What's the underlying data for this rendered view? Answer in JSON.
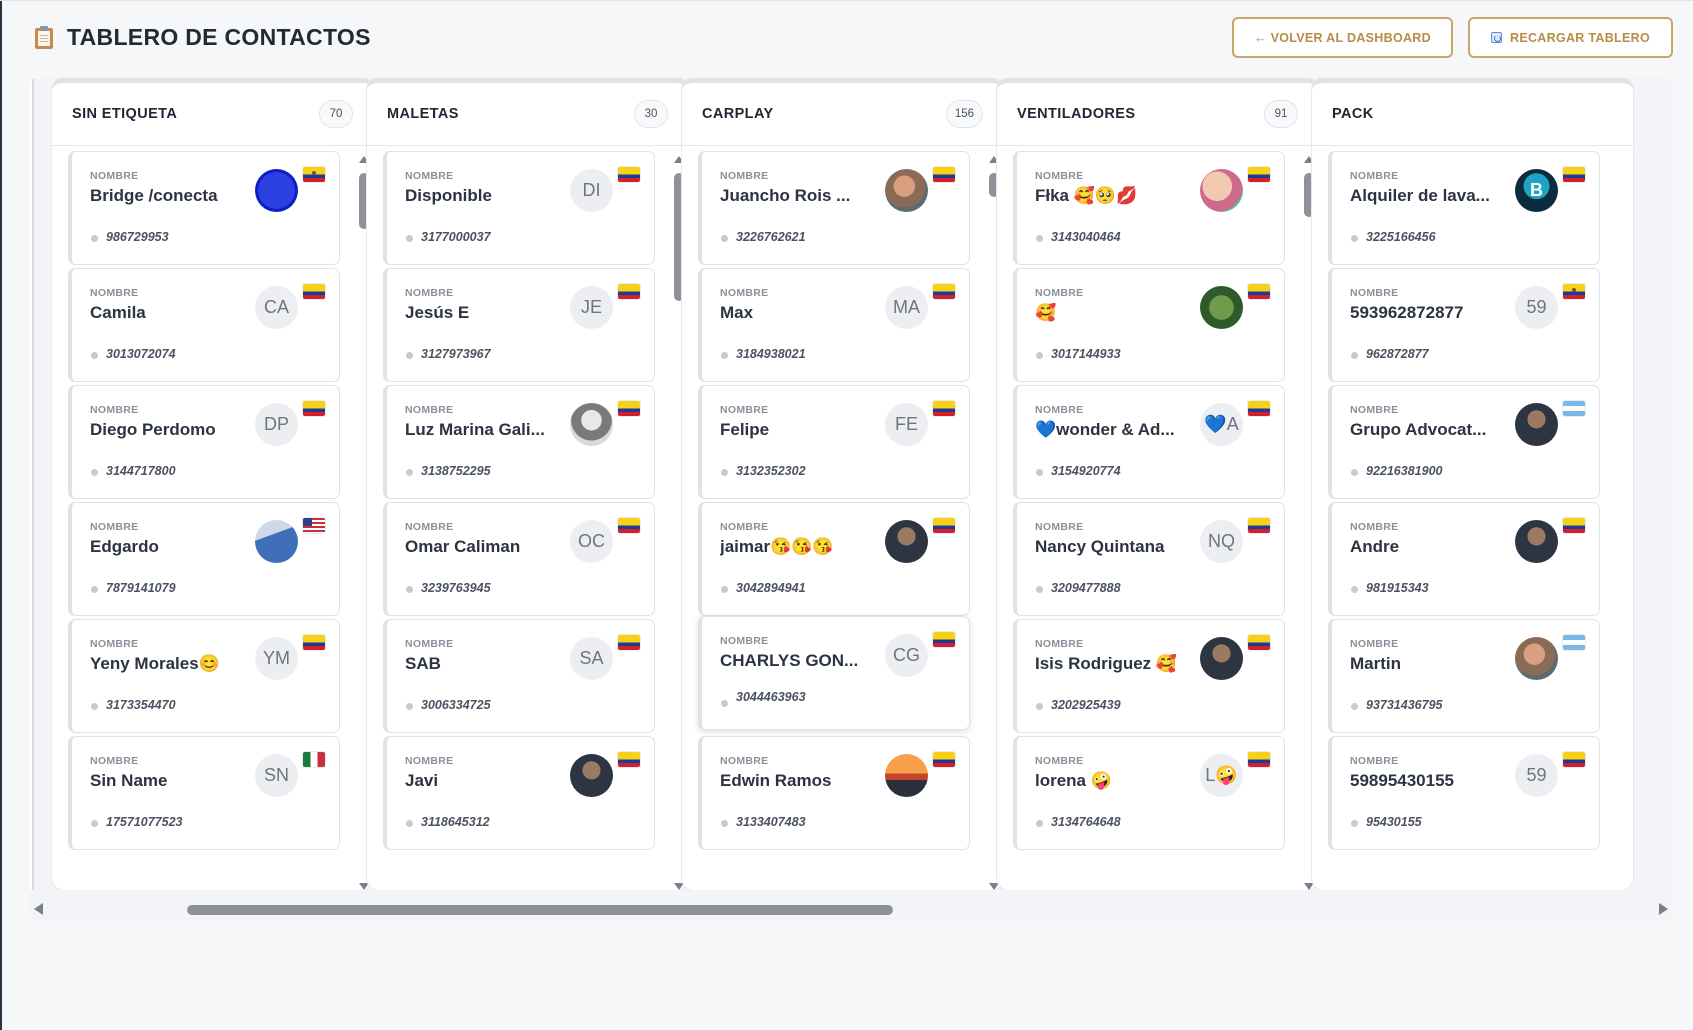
{
  "page": {
    "title": "TABLERO DE CONTACTOS",
    "icon": "clipboard-icon"
  },
  "buttons": {
    "back_label": "← VOLVER AL DASHBOARD",
    "reload_label": "RECARGAR TABLERO"
  },
  "colors": {
    "accent": "#caa56a",
    "accent_text": "#b78c47",
    "column_border": "#dfe2e7",
    "scroll_thumb": "#8e9198"
  },
  "field_label": "NOMBRE",
  "columns": [
    {
      "title": "SIN ETIQUETA",
      "count": "70",
      "cards": [
        {
          "name": "Bridge /conecta",
          "phone": "986729953",
          "avatar": "",
          "avatar_type": "logo-blue",
          "flag": "ec"
        },
        {
          "name": "Camila",
          "phone": "3013072074",
          "avatar": "CA",
          "avatar_type": "initials",
          "flag": "co"
        },
        {
          "name": "Diego Perdomo",
          "phone": "3144717800",
          "avatar": "DP",
          "avatar_type": "initials",
          "flag": "co"
        },
        {
          "name": "Edgardo",
          "phone": "7879141079",
          "avatar": "",
          "avatar_type": "photo-blue",
          "flag": "us"
        },
        {
          "name": "Yeny Morales😊",
          "phone": "3173354470",
          "avatar": "YM",
          "avatar_type": "initials",
          "flag": "co"
        },
        {
          "name": "Sin Name",
          "phone": "17571077523",
          "avatar": "SN",
          "avatar_type": "initials",
          "flag": "mx"
        }
      ]
    },
    {
      "title": "MALETAS",
      "count": "30",
      "cards": [
        {
          "name": "Disponible",
          "phone": "3177000037",
          "avatar": "DI",
          "avatar_type": "initials",
          "flag": "co"
        },
        {
          "name": "Jesús E",
          "phone": "3127973967",
          "avatar": "JE",
          "avatar_type": "initials",
          "flag": "co"
        },
        {
          "name": "Luz Marina Gali...",
          "phone": "3138752295",
          "avatar": "",
          "avatar_type": "photo-gray",
          "flag": "co"
        },
        {
          "name": "Omar Caliman",
          "phone": "3239763945",
          "avatar": "OC",
          "avatar_type": "initials",
          "flag": "co"
        },
        {
          "name": "SAB",
          "phone": "3006334725",
          "avatar": "SA",
          "avatar_type": "initials",
          "flag": "co"
        },
        {
          "name": "Javi",
          "phone": "3118645312",
          "avatar": "",
          "avatar_type": "photo-dark",
          "flag": "co"
        }
      ]
    },
    {
      "title": "CARPLAY",
      "count": "156",
      "cards": [
        {
          "name": "Juancho Rois ...",
          "phone": "3226762621",
          "avatar": "",
          "avatar_type": "photo-warm",
          "flag": "co"
        },
        {
          "name": "Max",
          "phone": "3184938021",
          "avatar": "MA",
          "avatar_type": "initials",
          "flag": "co"
        },
        {
          "name": "Felipe",
          "phone": "3132352302",
          "avatar": "FE",
          "avatar_type": "initials",
          "flag": "co"
        },
        {
          "name": "jaimar😘😘😘",
          "phone": "3042894941",
          "avatar": "",
          "avatar_type": "photo-dark",
          "flag": "co"
        },
        {
          "name": "CHARLYS GON...",
          "phone": "3044463963",
          "avatar": "CG",
          "avatar_type": "initials",
          "flag": "co"
        },
        {
          "name": "Edwin Ramos",
          "phone": "3133407483",
          "avatar": "",
          "avatar_type": "photo-sunset",
          "flag": "co"
        }
      ]
    },
    {
      "title": "VENTILADORES",
      "count": "91",
      "cards": [
        {
          "name": "Fłka 🥰🥺💋",
          "phone": "3143040464",
          "avatar": "",
          "avatar_type": "photo-pink",
          "flag": "co"
        },
        {
          "name": "🥰",
          "phone": "3017144933",
          "avatar": "",
          "avatar_type": "photo-green",
          "flag": "co"
        },
        {
          "name": "💙wonder & Ad...",
          "phone": "3154920774",
          "avatar": "💙A",
          "avatar_type": "initials",
          "flag": "co"
        },
        {
          "name": "Nancy Quintana",
          "phone": "3209477888",
          "avatar": "NQ",
          "avatar_type": "initials",
          "flag": "co"
        },
        {
          "name": "Isis Rodriguez 🥰",
          "phone": "3202925439",
          "avatar": "",
          "avatar_type": "photo-dark",
          "flag": "co"
        },
        {
          "name": "lorena 🤪",
          "phone": "3134764648",
          "avatar": "L🤪",
          "avatar_type": "initials",
          "flag": "co"
        }
      ]
    },
    {
      "title": "PACK",
      "count": "",
      "cards": [
        {
          "name": "Alquiler de lava...",
          "phone": "3225166456",
          "avatar": "B",
          "avatar_type": "logo-teal",
          "flag": "co"
        },
        {
          "name": "593962872877",
          "phone": "962872877",
          "avatar": "59",
          "avatar_type": "initials",
          "flag": "ec"
        },
        {
          "name": "Grupo Advocat...",
          "phone": "92216381900",
          "avatar": "",
          "avatar_type": "photo-dark",
          "flag": "ar"
        },
        {
          "name": "Andre",
          "phone": "981915343",
          "avatar": "",
          "avatar_type": "photo-dark",
          "flag": "co"
        },
        {
          "name": "Martin",
          "phone": "93731436795",
          "avatar": "",
          "avatar_type": "photo-warm",
          "flag": "ar"
        },
        {
          "name": "59895430155",
          "phone": "95430155",
          "avatar": "59",
          "avatar_type": "initials",
          "flag": "co"
        }
      ]
    }
  ]
}
